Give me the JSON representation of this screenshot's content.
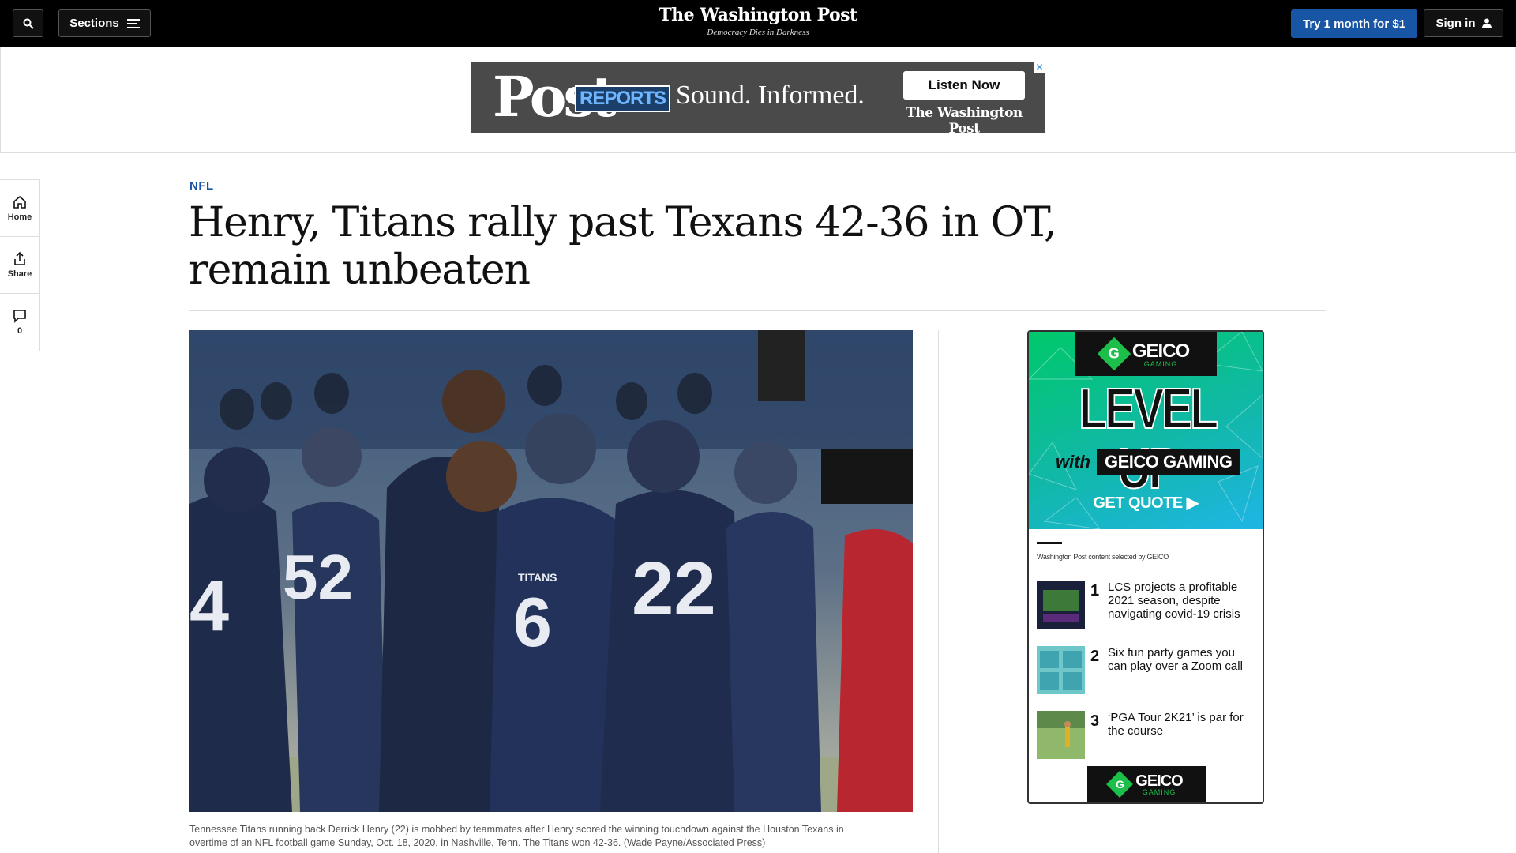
{
  "header": {
    "sections_label": "Sections",
    "logo": "The Washington Post",
    "tagline": "Democracy Dies in Darkness",
    "subscribe_label": "Try 1 month for $1",
    "signin_label": "Sign in"
  },
  "banner_ad": {
    "brand_post": "Post",
    "brand_reports": "REPORTS",
    "slogan": "Sound. Informed.",
    "cta": "Listen Now",
    "brand_wp": "The Washington Post",
    "close": "✕"
  },
  "rail": {
    "home_label": "Home",
    "share_label": "Share",
    "comments_count": "0"
  },
  "article": {
    "kicker": "NFL",
    "headline": "Henry, Titans rally past Texans 42-36 in OT, remain unbeaten",
    "caption": "Tennessee Titans running back Derrick Henry (22) is mobbed by teammates after Henry scored the winning touchdown against the Houston Texans in overtime of an NFL football game Sunday, Oct. 18, 2020, in Nashville, Tenn. The Titans won 42-36. (Wade Payne/Associated Press)"
  },
  "photo_jerseys": {
    "player_a": "4",
    "player_b": "52",
    "player_c": "6",
    "player_d": "22",
    "team_text": "TITANS"
  },
  "side_ad": {
    "geico": "GEICO",
    "gaming": "GAMING",
    "g_mark": "G",
    "headline": "LEVEL UP",
    "with": "with",
    "geico_gaming": "GEICO GAMING",
    "cta": "GET QUOTE ▶",
    "selected_by": "Washington Post content selected by GEICO",
    "items": [
      {
        "num": "1",
        "text": "LCS projects a profitable 2021 season, despite navigating covid-19 crisis"
      },
      {
        "num": "2",
        "text": "Six fun party games you can play over a Zoom call"
      },
      {
        "num": "3",
        "text": "‘PGA Tour 2K21’ is par for the course"
      }
    ]
  },
  "colors": {
    "accent_blue": "#1955a5",
    "topbar": "#000000",
    "geico_green": "#1bbf4a"
  }
}
